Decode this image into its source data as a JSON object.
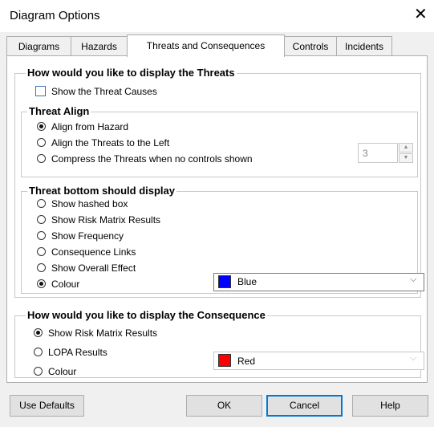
{
  "window": {
    "title": "Diagram Options",
    "close_glyph": "✕"
  },
  "tabs": [
    {
      "label": "Diagrams",
      "active": false
    },
    {
      "label": "Hazards",
      "active": false
    },
    {
      "label": "Threats and Consequences",
      "active": true
    },
    {
      "label": "Controls",
      "active": false
    },
    {
      "label": "Incidents",
      "active": false
    }
  ],
  "threats": {
    "group_title": "How would you like to display the Threats",
    "show_causes": {
      "label": "Show the Threat Causes",
      "checked": false
    },
    "align": {
      "group_title": "Threat Align",
      "options": [
        {
          "label": "Align from Hazard",
          "selected": true
        },
        {
          "label": "Align the Threats to the Left",
          "selected": false
        },
        {
          "label": "Compress the Threats when no controls shown",
          "selected": false
        }
      ],
      "compress_value": "3"
    },
    "bottom": {
      "group_title": "Threat bottom should display",
      "options": [
        {
          "label": "Show hashed box",
          "selected": false
        },
        {
          "label": "Show Risk Matrix Results",
          "selected": false
        },
        {
          "label": "Show Frequency",
          "selected": false
        },
        {
          "label": "Consequence Links",
          "selected": false
        },
        {
          "label": "Show Overall Effect",
          "selected": false
        },
        {
          "label": "Colour",
          "selected": true
        }
      ],
      "colour": {
        "value": "Blue",
        "swatch": "#0000ff"
      }
    }
  },
  "consequence": {
    "group_title": "How would you like to display the Consequence",
    "options": [
      {
        "label": "Show Risk Matrix Results",
        "selected": true
      },
      {
        "label": "LOPA Results",
        "selected": false
      },
      {
        "label": "Colour",
        "selected": false
      }
    ],
    "colour": {
      "value": "Red",
      "swatch": "#ff0000"
    }
  },
  "buttons": {
    "use_defaults": "Use Defaults",
    "ok": "OK",
    "cancel": "Cancel",
    "help": "Help"
  },
  "icons": {
    "dropdown": "chevron-down-icon",
    "spin_up": "▲",
    "spin_down": "▼",
    "chevron": "⌵"
  }
}
